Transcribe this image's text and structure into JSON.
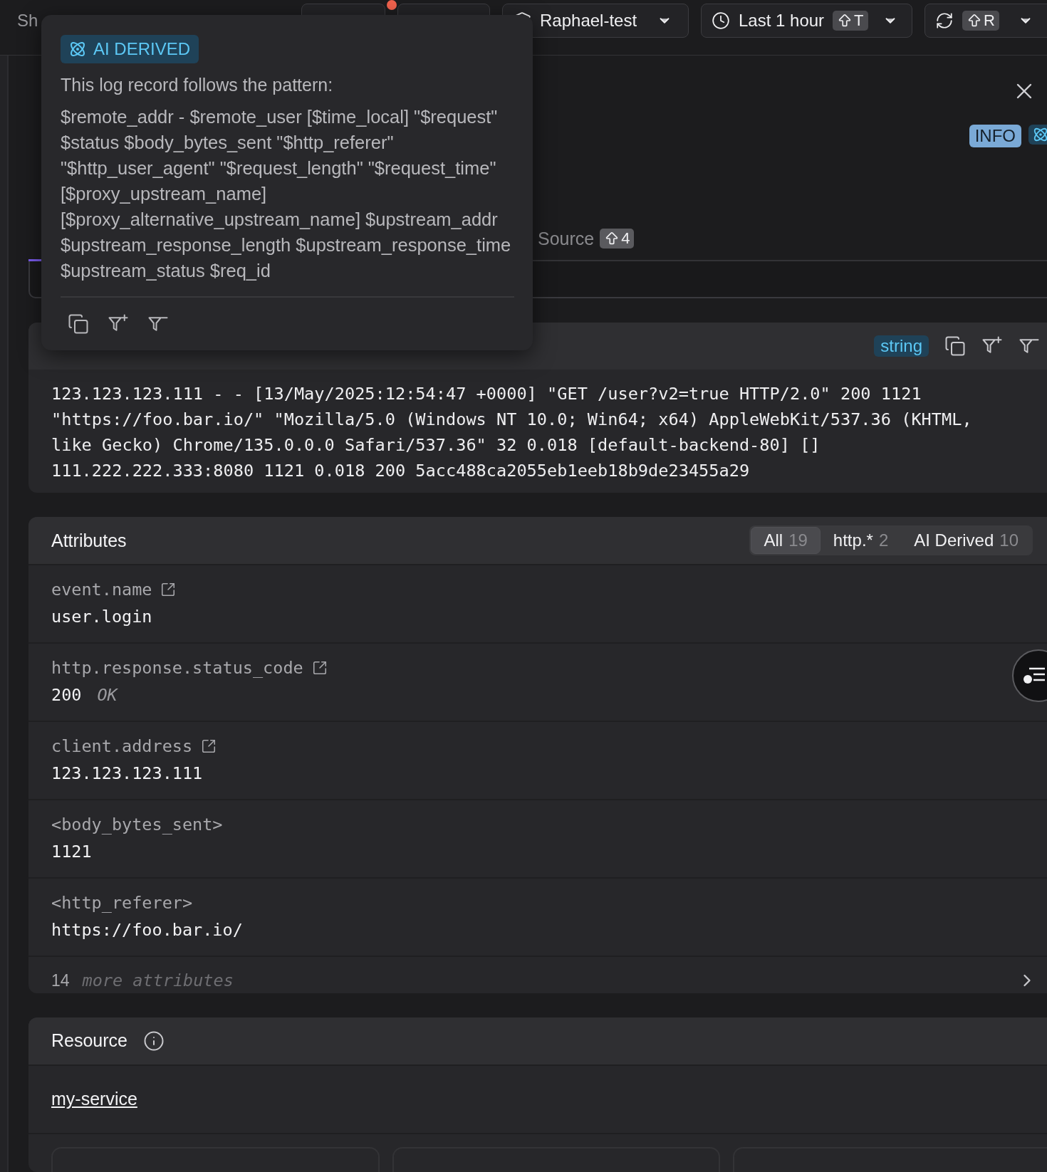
{
  "toolbar": {
    "status_text": "Sh",
    "workspace": {
      "label": "Raphael-test"
    },
    "time_range": {
      "label": "Last 1 hour",
      "shortcut_key": "T"
    },
    "refresh": {
      "shortcut_key": "R"
    }
  },
  "popover": {
    "badge": "AI DERIVED",
    "intro": "This log record follows the pattern:",
    "pattern": "$remote_addr - $remote_user [$time_local] \"$request\" $status $body_bytes_sent \"$http_referer\" \"$http_user_agent\" \"$request_length\" \"$request_time\" [$proxy_upstream_name] [$proxy_alternative_upstream_name] $upstream_addr $upstream_response_length $upstream_response_time $upstream_status $req_id"
  },
  "detail": {
    "level": "INFO",
    "tabs": [
      {
        "selected": true
      },
      {
        "label": "Source",
        "shortcut_key": "4",
        "selected": false
      }
    ],
    "body": {
      "type": "string",
      "text": "123.123.123.111 - - [13/May/2025:12:54:47 +0000] \"GET /user?v2=true HTTP/2.0\" 200 1121 \"https://foo.bar.io/\" \"Mozilla/5.0 (Windows NT 10.0; Win64; x64) AppleWebKit/537.36 (KHTML, like Gecko) Chrome/135.0.0.0 Safari/537.36\" 32 0.018 [default-backend-80] [] 111.222.222.333:8080 1121 0.018 200 5acc488ca2055eb1eeb18b9de23455a29"
    },
    "attributes": {
      "title": "Attributes",
      "filters": [
        {
          "label": "All",
          "count": "19",
          "selected": true
        },
        {
          "label": "http.*",
          "count": "2",
          "selected": false
        },
        {
          "label": "AI Derived",
          "count": "10",
          "selected": false
        }
      ],
      "rows": [
        {
          "key": "event.name",
          "value": "user.login",
          "link": true
        },
        {
          "key": "http.response.status_code",
          "value": "200",
          "note": "OK",
          "link": true
        },
        {
          "key": "client.address",
          "value": "123.123.123.111",
          "link": true
        },
        {
          "key": "<body_bytes_sent>",
          "value": "1121",
          "link": false
        },
        {
          "key": "<http_referer>",
          "value": "https://foo.bar.io/",
          "link": false
        }
      ],
      "more": {
        "count": "14",
        "label": "more attributes"
      }
    },
    "resource": {
      "title": "Resource",
      "service": "my-service"
    }
  }
}
